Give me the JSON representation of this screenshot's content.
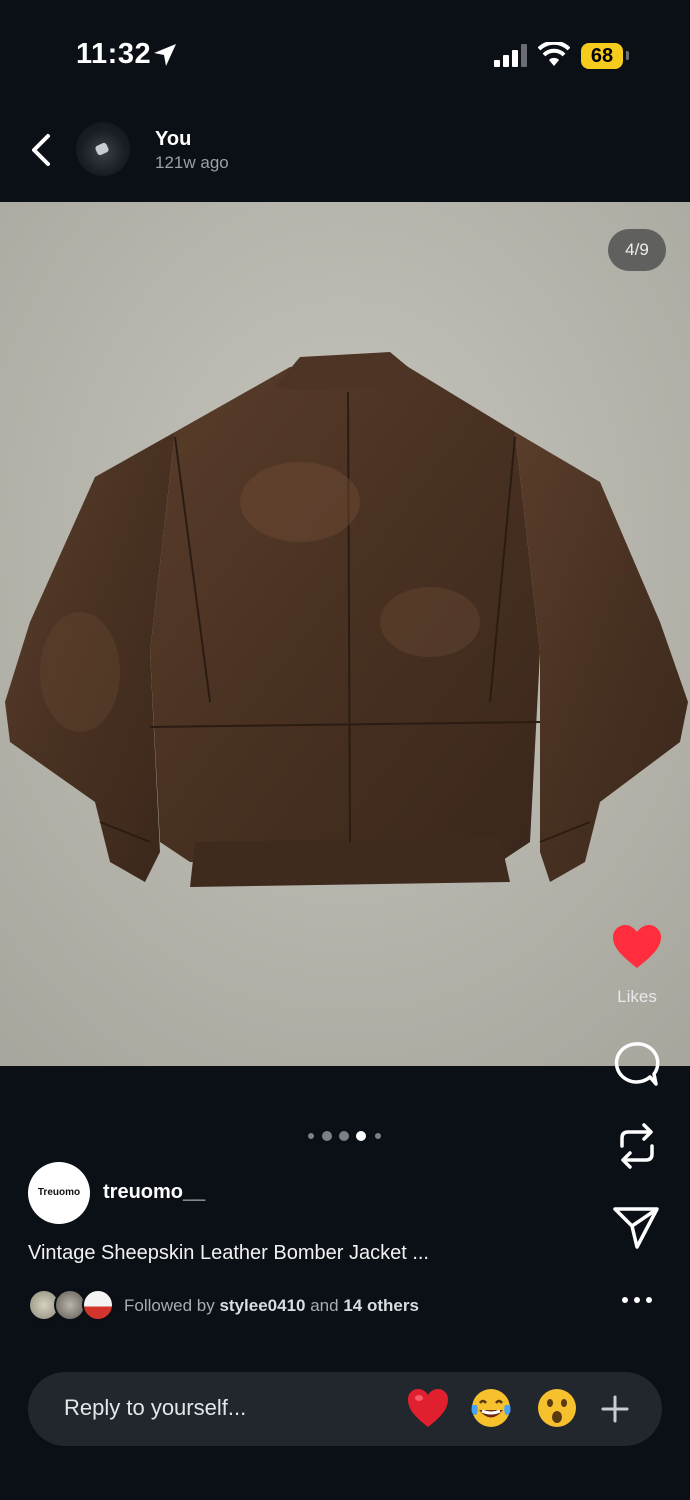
{
  "status_bar": {
    "time": "11:32",
    "battery": "68"
  },
  "header": {
    "user_name": "You",
    "post_time": "121w ago"
  },
  "story": {
    "image_description_icon": "leather-jacket-photo",
    "counter": "4/9",
    "current_slide": 4,
    "total_slides": 9
  },
  "actions": {
    "likes_label": "Likes"
  },
  "post": {
    "profile_avatar_text": "Treuomo",
    "username": "treuomo__",
    "caption": "Vintage Sheepskin Leather Bomber Jacket ...",
    "followed_by_prefix": "Followed by",
    "followed_by_user": "stylee0410",
    "followed_by_and": "and",
    "followed_by_others": "14 others"
  },
  "reply": {
    "placeholder": "Reply to yourself...",
    "quick_reactions": [
      "heart",
      "tears-of-joy",
      "astonished"
    ]
  },
  "colors": {
    "background": "#0b0f16",
    "heart": "#ff2d3d",
    "battery": "#f5cc1e"
  }
}
